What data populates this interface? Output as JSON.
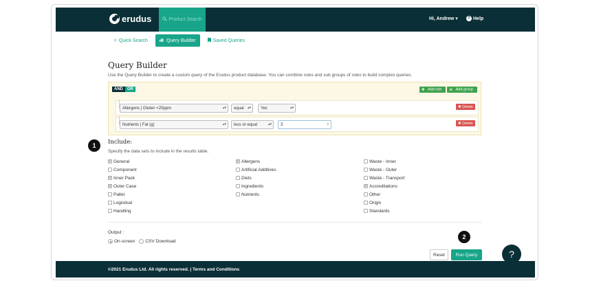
{
  "nav": {
    "brand": "erudus",
    "product_search": "Product Search",
    "user": "Hi, Andrew",
    "help": "Help"
  },
  "tabs": [
    {
      "label": "Quick Search",
      "icon": "bolt-icon",
      "active": false
    },
    {
      "label": "Query Builder",
      "icon": "chart-icon",
      "active": true
    },
    {
      "label": "Saved Queries",
      "icon": "bookmark-icon",
      "active": false
    }
  ],
  "page": {
    "title": "Query Builder",
    "description": "Use the Query Builder to create a custom query of the Erudus product database. You can combine rules and sub groups of rules to build complex queries."
  },
  "builder": {
    "and_label": "AND",
    "or_label": "OR",
    "add_rule": "Add rule",
    "add_group": "Add group",
    "rules": [
      {
        "field": "Allergens | Gluten <20ppm",
        "operator": "equal",
        "value": "Yes",
        "delete": "Delete"
      },
      {
        "field": "Nutrients | Fat (g)",
        "operator": "less or equal",
        "value": "3",
        "delete": "Delete"
      }
    ]
  },
  "include": {
    "title": "Include:",
    "description": "Specify the data sets to include in the results table.",
    "columns": [
      [
        {
          "label": "General",
          "checked": true
        },
        {
          "label": "Component",
          "checked": false
        },
        {
          "label": "Inner Pack",
          "checked": true
        },
        {
          "label": "Outer Case",
          "checked": true
        },
        {
          "label": "Pallet",
          "checked": false
        },
        {
          "label": "Logistical",
          "checked": false
        },
        {
          "label": "Handling",
          "checked": false
        }
      ],
      [
        {
          "label": "Allergens",
          "checked": true
        },
        {
          "label": "Artificial Additives",
          "checked": false
        },
        {
          "label": "Diets",
          "checked": false
        },
        {
          "label": "Ingredients",
          "checked": false
        },
        {
          "label": "Nutrients",
          "checked": false
        }
      ],
      [
        {
          "label": "Waste - Inner",
          "checked": false
        },
        {
          "label": "Waste - Outer",
          "checked": false
        },
        {
          "label": "Waste - Transport",
          "checked": false
        },
        {
          "label": "Accreditations",
          "checked": true
        },
        {
          "label": "Other",
          "checked": false
        },
        {
          "label": "Origin",
          "checked": false
        },
        {
          "label": "Standards",
          "checked": false
        }
      ]
    ]
  },
  "output": {
    "label": "Output :",
    "options": [
      {
        "label": "On-screen",
        "selected": true
      },
      {
        "label": "CSV Download",
        "selected": false
      }
    ]
  },
  "actions": {
    "reset": "Reset",
    "run": "Run Query"
  },
  "help_bubble": "?",
  "footer": "©2021 Erudus Ltd. All rights reserved. | Terms and Conditions",
  "markers": [
    "1",
    "2"
  ]
}
